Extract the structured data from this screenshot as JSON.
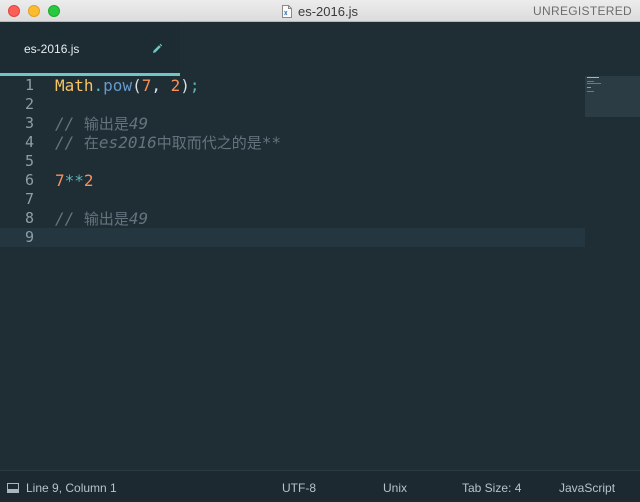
{
  "window": {
    "title": "es-2016.js",
    "registration": "UNREGISTERED"
  },
  "tab": {
    "label": "es-2016.js"
  },
  "editor": {
    "lines": [
      {
        "n": "1"
      },
      {
        "n": "2"
      },
      {
        "n": "3"
      },
      {
        "n": "4"
      },
      {
        "n": "5"
      },
      {
        "n": "6"
      },
      {
        "n": "7"
      },
      {
        "n": "8"
      },
      {
        "n": "9"
      }
    ],
    "tokens": {
      "l1_cls": "Math",
      "l1_dot": ".",
      "l1_fn": "pow",
      "l1_open": "(",
      "l1_a": "7",
      "l1_comma": ", ",
      "l1_b": "2",
      "l1_close": ")",
      "l1_semi": ";",
      "l3_slash": "// ",
      "l3_text": "输出是",
      "l3_num": "49",
      "l4_slash": "// ",
      "l4_text1": "在",
      "l4_latin": "es2016",
      "l4_text2": "中取而代之的是",
      "l4_op": "**",
      "l6_a": "7",
      "l6_op": "**",
      "l6_b": "2",
      "l8_slash": "// ",
      "l8_text": "输出是",
      "l8_num": "49"
    },
    "current_line": 9
  },
  "statusbar": {
    "position": "Line 9, Column 1",
    "encoding": "UTF-8",
    "line_endings": "Unix",
    "tab_size": "Tab Size: 4",
    "syntax": "JavaScript"
  },
  "icons": {
    "file": "js-file-icon",
    "edit": "pencil-icon",
    "panel": "panel-toggle-icon"
  },
  "colors": {
    "background": "#1f2d35",
    "accent": "#70c7c2",
    "number": "#f99157",
    "class": "#f7c562",
    "function": "#6699cc",
    "comment": "#65737e"
  }
}
